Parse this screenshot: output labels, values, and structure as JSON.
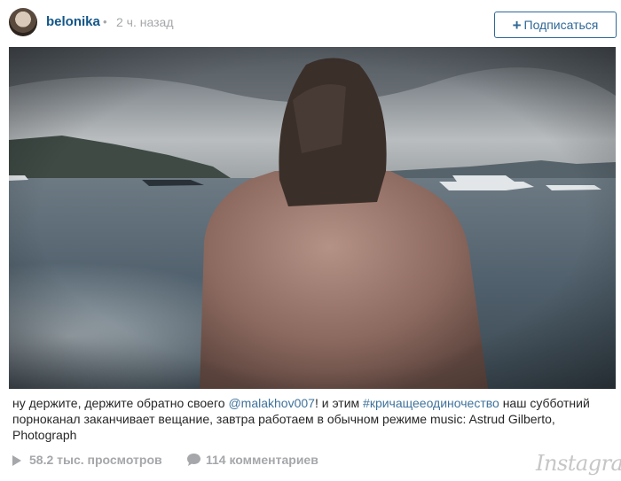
{
  "post": {
    "username": "belonika",
    "dot": "•",
    "time": "2 ч. назад",
    "follow_label": "Подписаться",
    "follow_icon": "plus-icon"
  },
  "caption": {
    "part1": "ну держите, держите обратно своего ",
    "mention": "@malakhov007",
    "part2": "! и этим ",
    "hashtag": "#кричащееодиночество",
    "part3": " наш субботний порноканал заканчивает вещание, завтра работаем в обычном режиме music: Astrud Gilberto, Photograph"
  },
  "stats": {
    "views": "58.2 тыс. просмотров",
    "comments": "114 комментариев"
  },
  "brand": "Instagram",
  "colors": {
    "username": "#125688",
    "link": "#3f729b",
    "muted": "#a5a7aa",
    "follow_border": "#2f6896"
  }
}
